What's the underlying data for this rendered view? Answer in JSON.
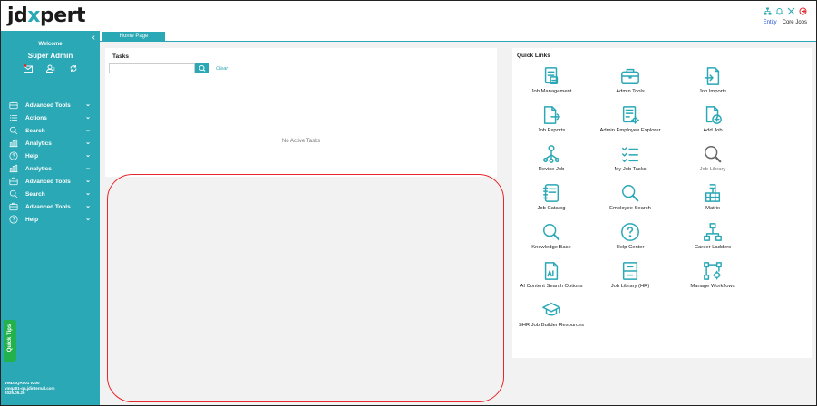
{
  "header": {
    "logo_left": "jd",
    "logo_x": "x",
    "logo_right": "pert",
    "links": {
      "entity": "Entity",
      "core_jobs": "Core Jobs"
    }
  },
  "sidebar": {
    "collapse": "‹",
    "welcome": "Welcome",
    "user": "Super Admin",
    "items": [
      {
        "label": "Advanced Tools",
        "icon": "toolbox-icon"
      },
      {
        "label": "Actions",
        "icon": "list-icon"
      },
      {
        "label": "Search",
        "icon": "search-icon"
      },
      {
        "label": "Analytics",
        "icon": "chart-icon"
      },
      {
        "label": "Help",
        "icon": "help-icon"
      },
      {
        "label": "Analytics",
        "icon": "chart-icon"
      },
      {
        "label": "Advanced Tools",
        "icon": "toolbox-icon"
      },
      {
        "label": "Search",
        "icon": "search-icon"
      },
      {
        "label": "Advanced Tools",
        "icon": "toolbox-icon"
      },
      {
        "label": "Help",
        "icon": "help-icon"
      }
    ],
    "quick_tips": "Quick Tips",
    "version_line1": "VMDSQA001 v200",
    "version_line2": "vmqa01-qa.jdinternal.com",
    "version_line3": "2025.05.26"
  },
  "tabs": {
    "home": "Home Page"
  },
  "tasks": {
    "title": "Tasks",
    "search_placeholder": "",
    "clear": "Clear",
    "empty": "No Active Tasks"
  },
  "quick_links": {
    "title": "Quick Links",
    "items": [
      {
        "label": "Job Management",
        "icon": "job-management-icon"
      },
      {
        "label": "Admin Tools",
        "icon": "briefcase-icon"
      },
      {
        "label": "Job Imports",
        "icon": "file-import-icon"
      },
      {
        "label": "Job Exports",
        "icon": "file-export-icon"
      },
      {
        "label": "Admin Employee Explorer",
        "icon": "employee-explorer-icon"
      },
      {
        "label": "Add Job",
        "icon": "add-file-icon"
      },
      {
        "label": "Revise Job",
        "icon": "org-tree-icon"
      },
      {
        "label": "My Job Tasks",
        "icon": "task-list-icon"
      },
      {
        "label": "Job Library",
        "icon": "search-gray-icon"
      },
      {
        "label": "Job Catalog",
        "icon": "notebook-icon"
      },
      {
        "label": "Employee Search",
        "icon": "search-icon"
      },
      {
        "label": "Matrix",
        "icon": "matrix-icon"
      },
      {
        "label": "Knowledge Base",
        "icon": "search-icon"
      },
      {
        "label": "Help Center",
        "icon": "help-circle-icon"
      },
      {
        "label": "Career Ladders",
        "icon": "hierarchy-icon"
      },
      {
        "label": "AI Content Search Options",
        "icon": "ai-file-icon"
      },
      {
        "label": "Job Library (HR)",
        "icon": "cabinet-icon"
      },
      {
        "label": "Manage Workflows",
        "icon": "workflow-icon"
      },
      {
        "label": "SHR Job Builder Resources",
        "icon": "graduation-cap-icon"
      }
    ]
  },
  "colors": {
    "brand": "#2aa8b5",
    "highlight": "#e8262b",
    "quick_tips": "#22b14c"
  }
}
